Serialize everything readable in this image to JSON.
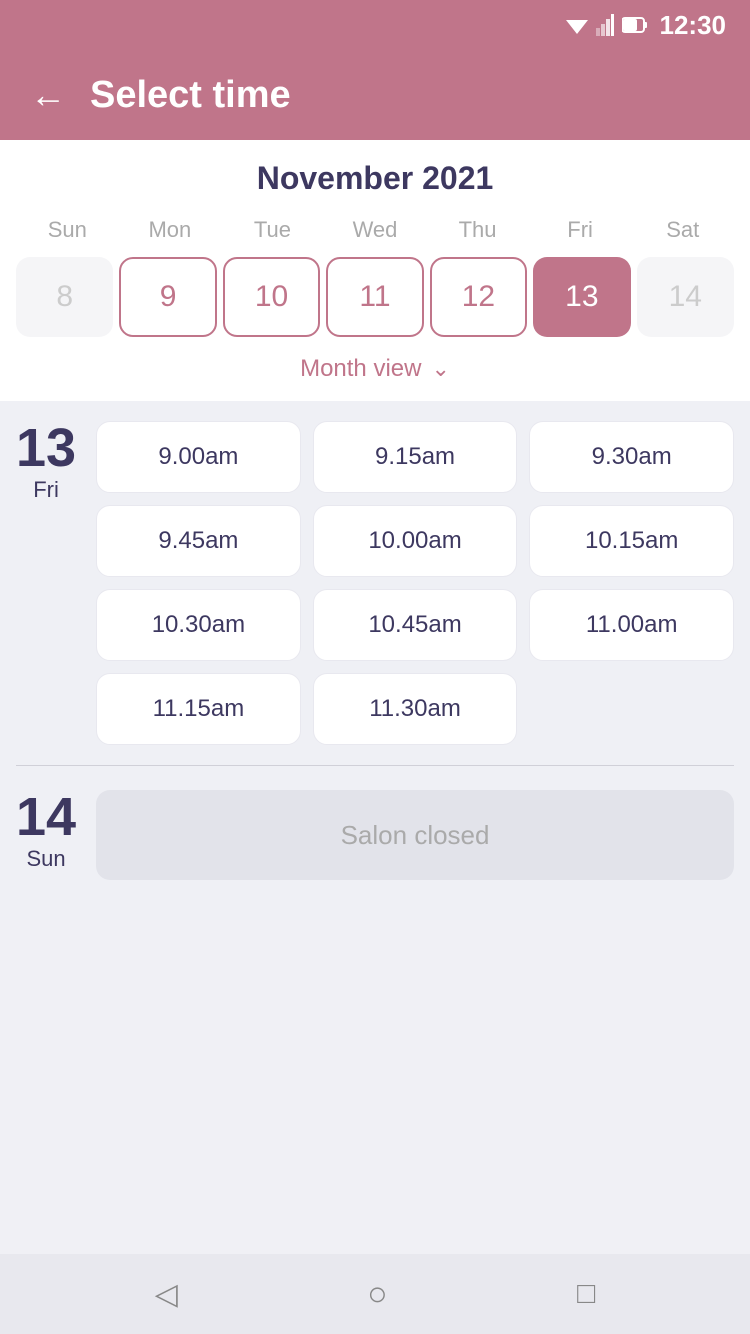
{
  "statusBar": {
    "time": "12:30"
  },
  "header": {
    "backLabel": "←",
    "title": "Select time"
  },
  "calendar": {
    "monthTitle": "November 2021",
    "weekdays": [
      "Sun",
      "Mon",
      "Tue",
      "Wed",
      "Thu",
      "Fri",
      "Sat"
    ],
    "dates": [
      {
        "value": "8",
        "state": "inactive"
      },
      {
        "value": "9",
        "state": "active"
      },
      {
        "value": "10",
        "state": "active"
      },
      {
        "value": "11",
        "state": "active"
      },
      {
        "value": "12",
        "state": "active"
      },
      {
        "value": "13",
        "state": "selected"
      },
      {
        "value": "14",
        "state": "inactive"
      }
    ],
    "monthViewLabel": "Month view"
  },
  "timeSections": [
    {
      "dayNumber": "13",
      "dayName": "Fri",
      "slots": [
        "9.00am",
        "9.15am",
        "9.30am",
        "9.45am",
        "10.00am",
        "10.15am",
        "10.30am",
        "10.45am",
        "11.00am",
        "11.15am",
        "11.30am"
      ]
    },
    {
      "dayNumber": "14",
      "dayName": "Sun",
      "slots": [],
      "closedLabel": "Salon closed"
    }
  ],
  "bottomNav": {
    "back": "◁",
    "home": "○",
    "recent": "□"
  }
}
